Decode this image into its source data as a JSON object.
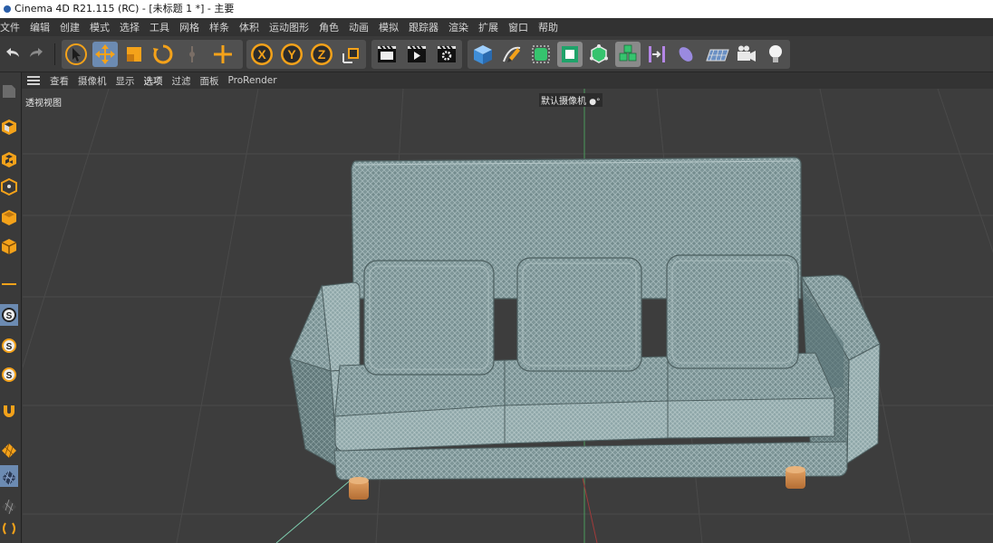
{
  "window": {
    "title": "Cinema 4D R21.115 (RC) - [未标题 1 *] - 主要"
  },
  "menu": [
    "文件",
    "编辑",
    "创建",
    "模式",
    "选择",
    "工具",
    "网格",
    "样条",
    "体积",
    "运动图形",
    "角色",
    "动画",
    "模拟",
    "跟踪器",
    "渲染",
    "扩展",
    "窗口",
    "帮助"
  ],
  "toolbar": {
    "buttons": [
      {
        "name": "undo-icon"
      },
      {
        "name": "redo-icon"
      },
      {
        "name": "select-cursor-icon"
      },
      {
        "name": "move-icon"
      },
      {
        "name": "scale-icon"
      },
      {
        "name": "rotate-icon"
      },
      {
        "name": "recent-tool-icon"
      },
      {
        "name": "transform-icon"
      },
      {
        "name": "x-axis-icon",
        "label": "X"
      },
      {
        "name": "y-axis-icon",
        "label": "Y"
      },
      {
        "name": "z-axis-icon",
        "label": "Z"
      },
      {
        "name": "coordinate-system-icon"
      },
      {
        "name": "render-view-icon"
      },
      {
        "name": "render-picture-viewer-icon"
      },
      {
        "name": "render-settings-icon"
      },
      {
        "name": "cube-icon"
      },
      {
        "name": "pen-spline-icon"
      },
      {
        "name": "subdivision-icon"
      },
      {
        "name": "extrude-icon"
      },
      {
        "name": "cloner-icon"
      },
      {
        "name": "array-icon"
      },
      {
        "name": "deformer-icon"
      },
      {
        "name": "field-icon"
      },
      {
        "name": "floor-icon"
      },
      {
        "name": "camera-icon"
      },
      {
        "name": "light-icon"
      }
    ]
  },
  "viewport_menu": {
    "items": [
      "查看",
      "摄像机",
      "显示",
      "选项",
      "过滤",
      "面板",
      "ProRender"
    ],
    "active_index": 3
  },
  "viewport": {
    "view_name": "透视视图",
    "camera_name": "默认摄像机"
  },
  "left_toolbar": {
    "buttons": [
      "make-editable-icon",
      "model-mode-icon",
      "texture-mode-icon",
      "workplane-icon",
      "points-mode-icon",
      "edges-mode-icon",
      "polygons-mode-icon",
      "axis-mode-icon",
      "snap-icon",
      "quantize-icon",
      "locked-workplane-icon",
      "magnet-icon",
      "polygon-pen-icon",
      "knife-icon",
      "weight-icon"
    ]
  },
  "colors": {
    "accent": "#f4a21a",
    "selected": "#6c8bb2",
    "fabric": "#7e9698",
    "legs": "#d08a4c"
  }
}
